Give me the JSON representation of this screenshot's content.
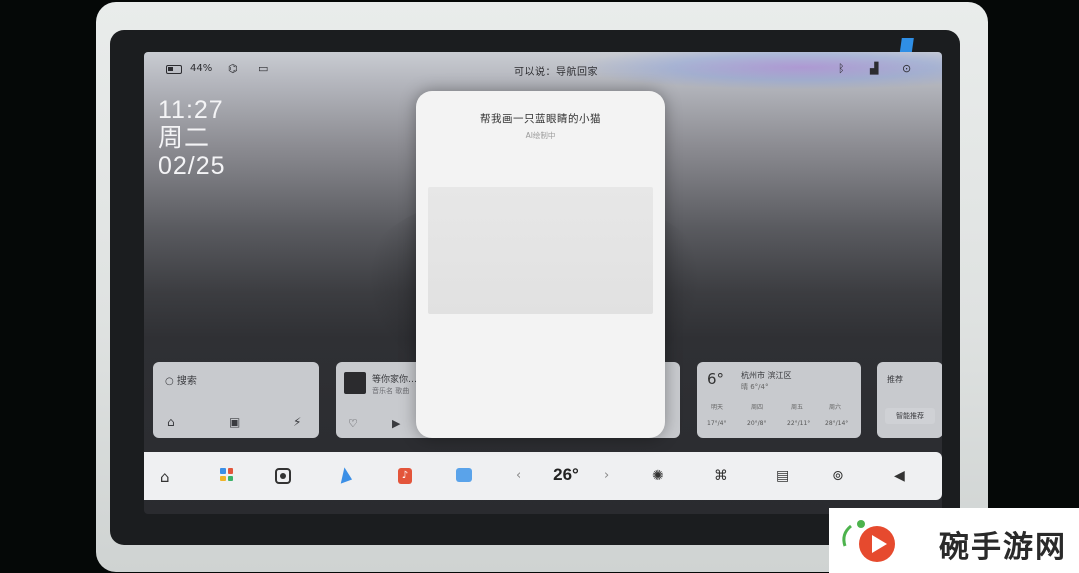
{
  "status_bar": {
    "battery_percent": "44%",
    "nav_hint": "可以说：导航回家"
  },
  "clock": {
    "time": "11:27",
    "weekday": "周二",
    "date": "02/25"
  },
  "widgets": {
    "search": {
      "label": "搜索"
    },
    "music": {
      "title": "等你家你…",
      "subtitle": "音乐名 歌曲"
    },
    "weather": {
      "temp": "6°",
      "city": "杭州市 滨江区",
      "condition": "晴 6°/4°",
      "forecast_days": [
        "明天",
        "周四",
        "周五",
        "周六"
      ],
      "forecast_ranges": [
        "17°/4°",
        "20°/8°",
        "22°/11°",
        "28°/14°"
      ]
    },
    "recommend": {
      "title": "推荐",
      "button": "智能推荐"
    }
  },
  "dock": {
    "temperature": "26°"
  },
  "ai_modal": {
    "prompt": "帮我画一只蓝眼睛的小猫",
    "status": "AI绘制中"
  },
  "watermark": {
    "text": "碗手游网"
  },
  "colors": {
    "accent_blue": "#3b8fe6",
    "music_red": "#e3553b",
    "dock_bg": "#eff0f2",
    "modal_bg": "#f3f3f3"
  }
}
